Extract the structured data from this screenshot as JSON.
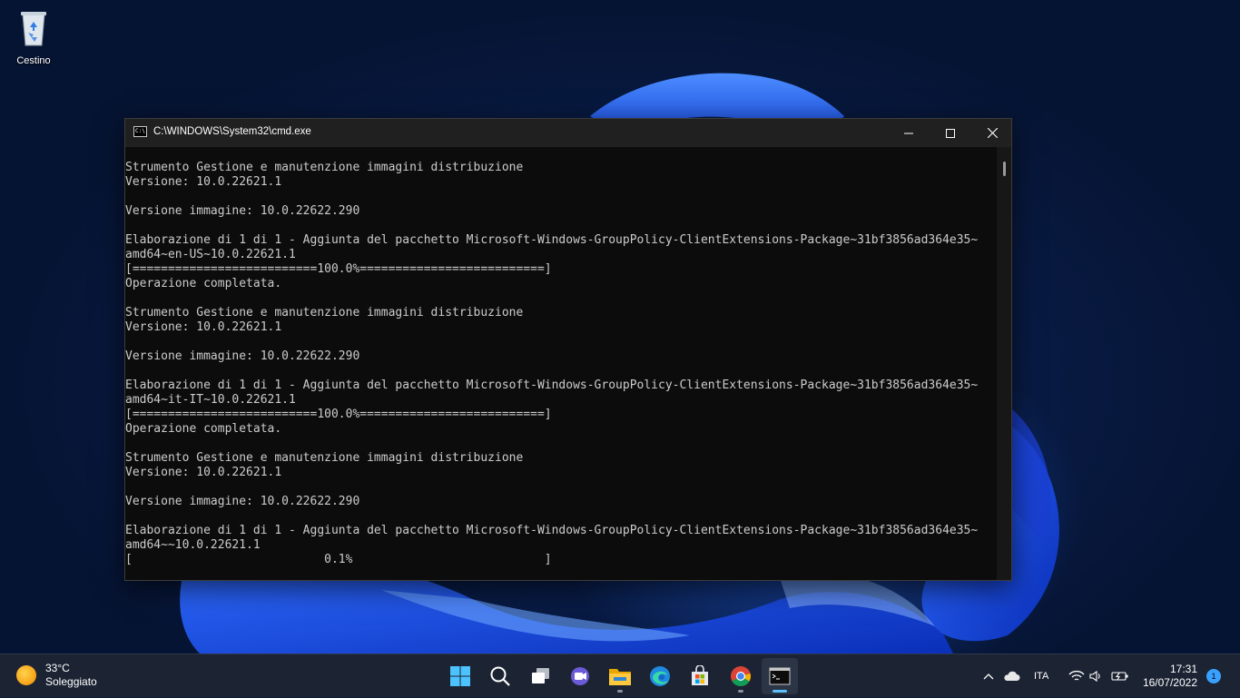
{
  "desktop": {
    "icons": [
      {
        "label": "Cestino",
        "icon": "recycle-bin-icon"
      }
    ]
  },
  "window": {
    "title": "C:\\WINDOWS\\System32\\cmd.exe",
    "console_lines": [
      "Strumento Gestione e manutenzione immagini distribuzione",
      "Versione: 10.0.22621.1",
      "",
      "Versione immagine: 10.0.22622.290",
      "",
      "Elaborazione di 1 di 1 - Aggiunta del pacchetto Microsoft-Windows-GroupPolicy-ClientExtensions-Package~31bf3856ad364e35~",
      "amd64~en-US~10.0.22621.1",
      "[==========================100.0%==========================]",
      "Operazione completata.",
      "",
      "Strumento Gestione e manutenzione immagini distribuzione",
      "Versione: 10.0.22621.1",
      "",
      "Versione immagine: 10.0.22622.290",
      "",
      "Elaborazione di 1 di 1 - Aggiunta del pacchetto Microsoft-Windows-GroupPolicy-ClientExtensions-Package~31bf3856ad364e35~",
      "amd64~it-IT~10.0.22621.1",
      "[==========================100.0%==========================]",
      "Operazione completata.",
      "",
      "Strumento Gestione e manutenzione immagini distribuzione",
      "Versione: 10.0.22621.1",
      "",
      "Versione immagine: 10.0.22622.290",
      "",
      "Elaborazione di 1 di 1 - Aggiunta del pacchetto Microsoft-Windows-GroupPolicy-ClientExtensions-Package~31bf3856ad364e35~",
      "amd64~~10.0.22621.1",
      "[                           0.1%                           ]"
    ]
  },
  "taskbar": {
    "weather": {
      "temperature": "33°C",
      "condition": "Soleggiato",
      "icon": "sun-icon"
    },
    "apps": [
      {
        "name": "start",
        "icon": "windows-start-icon",
        "running": false,
        "active": false
      },
      {
        "name": "search",
        "icon": "search-icon",
        "running": false,
        "active": false
      },
      {
        "name": "task-view",
        "icon": "task-view-icon",
        "running": false,
        "active": false
      },
      {
        "name": "teams-chat",
        "icon": "chat-icon",
        "running": false,
        "active": false
      },
      {
        "name": "file-explorer",
        "icon": "folder-icon",
        "running": true,
        "active": false
      },
      {
        "name": "edge",
        "icon": "edge-icon",
        "running": false,
        "active": false
      },
      {
        "name": "store",
        "icon": "store-icon",
        "running": false,
        "active": false
      },
      {
        "name": "chrome",
        "icon": "chrome-icon",
        "running": true,
        "active": false
      },
      {
        "name": "terminal",
        "icon": "terminal-icon",
        "running": true,
        "active": true
      }
    ],
    "tray": {
      "language": "ITA",
      "time": "17:31",
      "date": "16/07/2022",
      "notifications": "1"
    }
  },
  "colors": {
    "console_bg": "#0c0c0c",
    "console_fg": "#cccccc",
    "titlebar_bg": "#202020",
    "taskbar_bg": "#1c2433",
    "accent": "#5cc3ff"
  }
}
